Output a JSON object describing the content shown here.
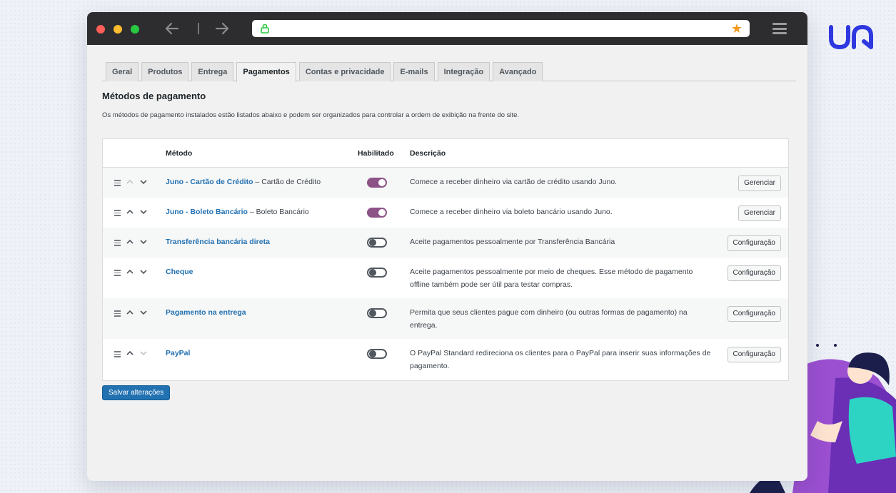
{
  "tabs": [
    "Geral",
    "Produtos",
    "Entrega",
    "Pagamentos",
    "Contas e privacidade",
    "E-mails",
    "Integração",
    "Avançado"
  ],
  "active_tab": "Pagamentos",
  "section": {
    "title": "Métodos de pagamento",
    "description": "Os métodos de pagamento instalados estão listados abaixo e podem ser organizados para controlar a ordem de exibição na frente do site."
  },
  "table": {
    "headers": {
      "method": "Método",
      "enabled": "Habilitado",
      "description": "Descrição"
    },
    "rows": [
      {
        "name": "Juno - Cartão de Crédito",
        "suffix": " – Cartão de Crédito",
        "enabled": true,
        "description": "Comece a receber dinheiro via cartão de crédito usando Juno.",
        "action": "Gerenciar"
      },
      {
        "name": "Juno - Boleto Bancário",
        "suffix": " – Boleto Bancário",
        "enabled": true,
        "description": "Comece a receber dinheiro via boleto bancário usando Juno.",
        "action": "Gerenciar"
      },
      {
        "name": "Transferência bancária direta",
        "suffix": "",
        "enabled": false,
        "description": "Aceite pagamentos pessoalmente por Transferência Bancária",
        "action": "Configuração"
      },
      {
        "name": "Cheque",
        "suffix": "",
        "enabled": false,
        "description": "Aceite pagamentos pessoalmente por meio de cheques. Esse método de pagamento offline também pode ser útil para testar compras.",
        "action": "Configuração"
      },
      {
        "name": "Pagamento na entrega",
        "suffix": "",
        "enabled": false,
        "description": "Permita que seus clientes pague com dinheiro (ou outras formas de pagamento) na entrega.",
        "action": "Configuração"
      },
      {
        "name": "PayPal",
        "suffix": "",
        "enabled": false,
        "description": "O PayPal Standard redireciona os clientes para o PayPal para inserir suas informações de pagamento.",
        "action": "Configuração"
      }
    ]
  },
  "save_label": "Salvar alterações",
  "colors": {
    "link": "#2271b1",
    "toggle_on": "#8c5387",
    "primary_button": "#2271b1",
    "star": "#f39a1f",
    "logo": "#2f38e0"
  }
}
